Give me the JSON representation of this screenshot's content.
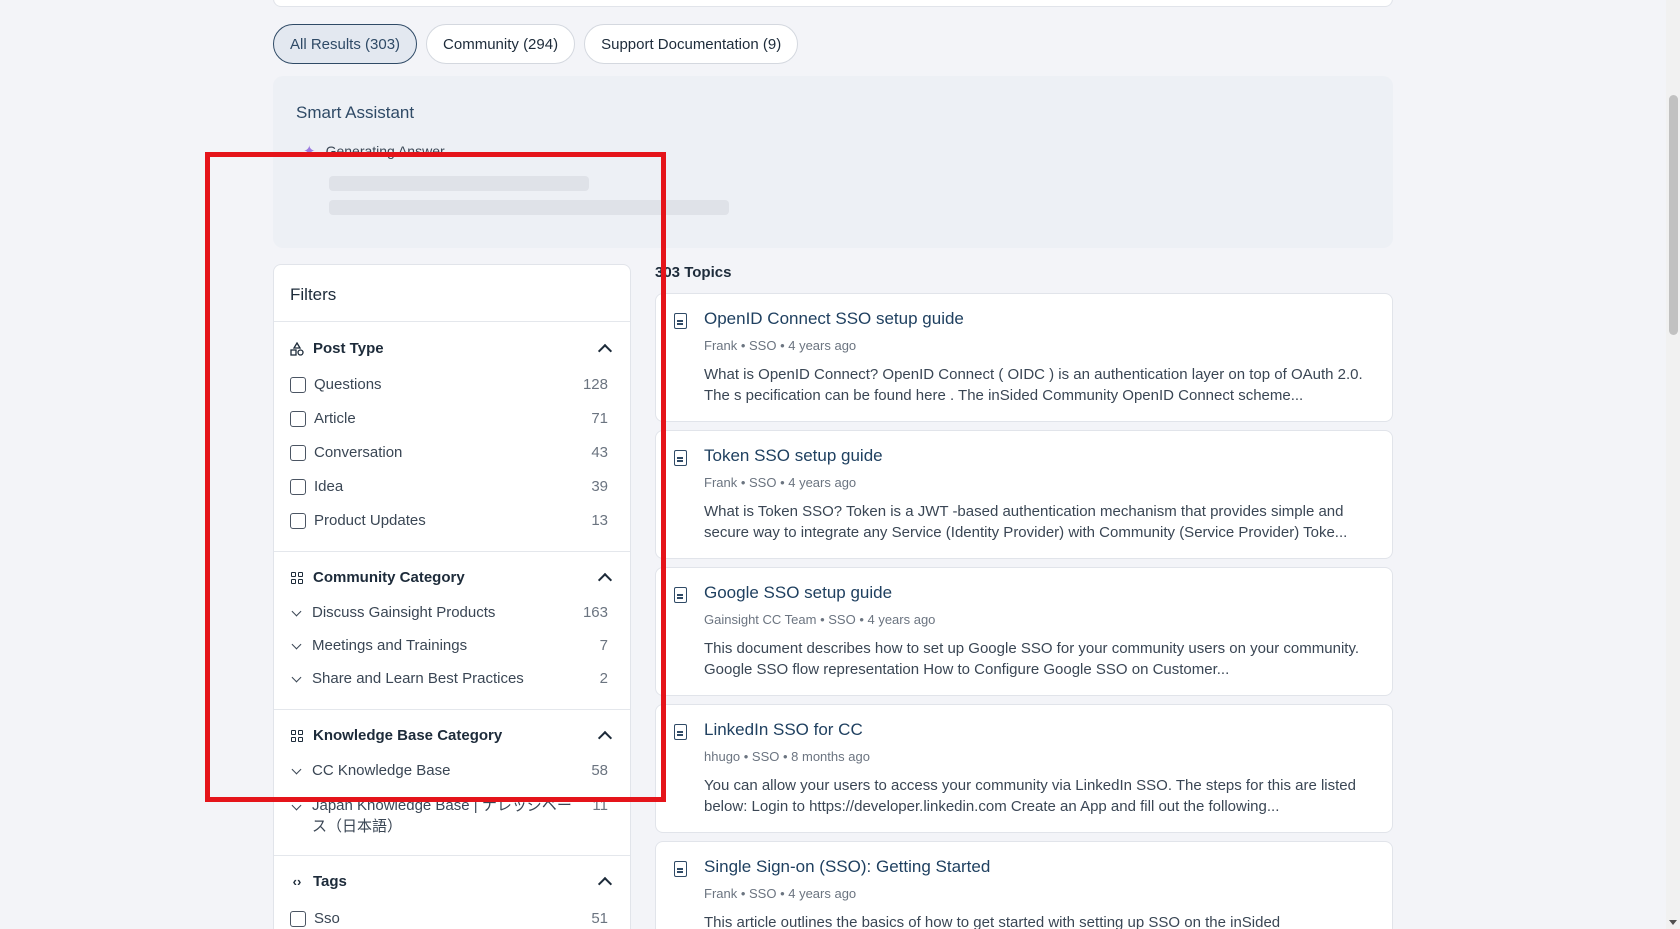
{
  "tabs": [
    {
      "label": "All Results (303)",
      "active": true
    },
    {
      "label": "Community (294)",
      "active": false
    },
    {
      "label": "Support Documentation (9)",
      "active": false
    }
  ],
  "assistant": {
    "title": "Smart Assistant",
    "status": "Generating Answer..."
  },
  "filters": {
    "title": "Filters",
    "post_type": {
      "label": "Post Type",
      "items": [
        {
          "label": "Questions",
          "count": "128"
        },
        {
          "label": "Article",
          "count": "71"
        },
        {
          "label": "Conversation",
          "count": "43"
        },
        {
          "label": "Idea",
          "count": "39"
        },
        {
          "label": "Product Updates",
          "count": "13"
        }
      ]
    },
    "community_category": {
      "label": "Community Category",
      "items": [
        {
          "label": "Discuss Gainsight Products",
          "count": "163"
        },
        {
          "label": "Meetings and Trainings",
          "count": "7"
        },
        {
          "label": "Share and Learn Best Practices",
          "count": "2"
        }
      ]
    },
    "knowledge_base_category": {
      "label": "Knowledge Base Category",
      "items": [
        {
          "label": "CC Knowledge Base",
          "count": "58"
        },
        {
          "label": "Japan Knowledge Base | ナレッジベース（日本語）",
          "count": "11"
        }
      ]
    },
    "tags": {
      "label": "Tags",
      "items": [
        {
          "label": "Sso",
          "count": "51"
        }
      ]
    }
  },
  "results": {
    "count_label": "303 Topics",
    "items": [
      {
        "title": "OpenID Connect SSO setup guide",
        "meta": "Frank • SSO • 4 years ago",
        "excerpt": "What is OpenID Connect? OpenID Connect ( OIDC ) is an authentication layer on top of OAuth 2.0. The s pecification can be found here . The inSided Community OpenID Connect scheme..."
      },
      {
        "title": "Token SSO setup guide",
        "meta": "Frank • SSO • 4 years ago",
        "excerpt": "What is Token SSO? Token is a JWT -based authentication mechanism that provides simple and secure way to integrate any Service (Identity Provider) with Community (Service Provider) Toke..."
      },
      {
        "title": "Google SSO setup guide",
        "meta": "Gainsight CC Team • SSO • 4 years ago",
        "excerpt": "This document describes how to set up Google SSO for your community users on your community. Google SSO flow representation How to Configure Google SSO on Customer..."
      },
      {
        "title": "LinkedIn SSO for CC",
        "meta": "hhugo • SSO • 8 months ago",
        "excerpt": "You can allow your users to access your community via LinkedIn SSO. The steps for this are listed below: Login to https://developer.linkedin.com Create an App and fill out the following..."
      },
      {
        "title": "Single Sign-on (SSO): Getting Started",
        "meta": "Frank • SSO • 4 years ago",
        "excerpt": "This article outlines the basics of how to get started with setting up SSO on the inSided"
      }
    ]
  },
  "colors": {
    "accent": "#2f4a66",
    "highlight_box": "#e5141a"
  }
}
